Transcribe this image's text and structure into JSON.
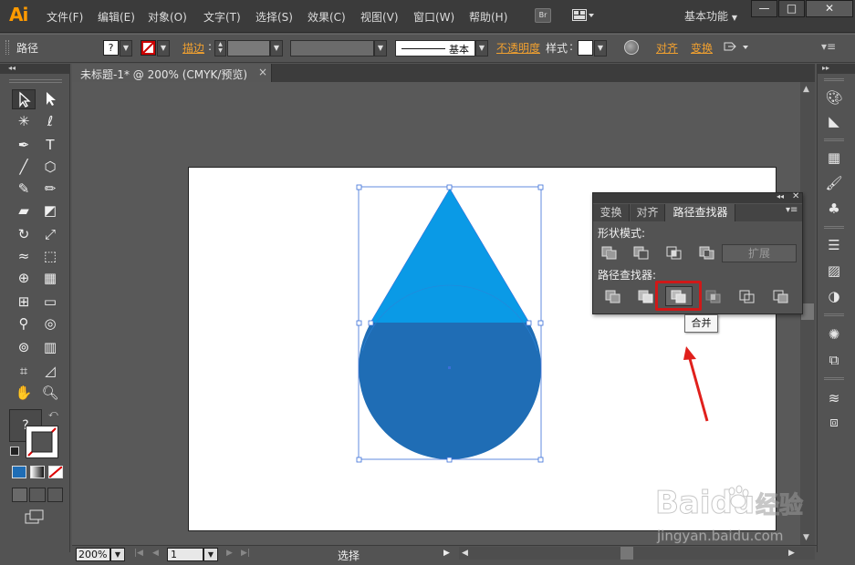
{
  "app": {
    "logo": "Ai",
    "menu": [
      "文件(F)",
      "编辑(E)",
      "对象(O)",
      "文字(T)",
      "选择(S)",
      "效果(C)",
      "视图(V)",
      "窗口(W)",
      "帮助(H)"
    ],
    "bridge_label": "Br",
    "workspace": "基本功能",
    "window_buttons": [
      "—",
      "□",
      "✕"
    ]
  },
  "control_bar": {
    "selection_label": "路径",
    "stroke_label": "描边",
    "stroke_style": "基本",
    "opacity_label": "不透明度",
    "style_label": "样式",
    "align_label": "对齐",
    "transform_label": "变换"
  },
  "document": {
    "tab_title": "未标题-1* @ 200% (CMYK/预览)",
    "close_symbol": "×"
  },
  "status_bar": {
    "zoom": "200%",
    "page": "1",
    "tool_status": "选择"
  },
  "toolbar": {
    "fill_stroke_label": "?",
    "color_modes": [
      "fill-color",
      "gradient",
      "none"
    ]
  },
  "pathfinder_panel": {
    "tabs": [
      "变换",
      "对齐",
      "路径查找器"
    ],
    "active_tab": "路径查找器",
    "shape_modes_label": "形状模式:",
    "pathfinders_label": "路径查找器:",
    "expand_button": "扩展",
    "tooltip": "合并"
  },
  "artwork": {
    "triangle_color": "#0a9ae6",
    "circle_color": "#1f6db5",
    "selection_color": "#3a6fd8"
  },
  "watermark": {
    "brand": "Baidu",
    "brand_suffix": "经验",
    "url": "jingyan.baidu.com"
  },
  "colors": {
    "highlight_red": "#d01818",
    "arrow_red": "#e0201c",
    "accent_orange": "#f0a030"
  }
}
